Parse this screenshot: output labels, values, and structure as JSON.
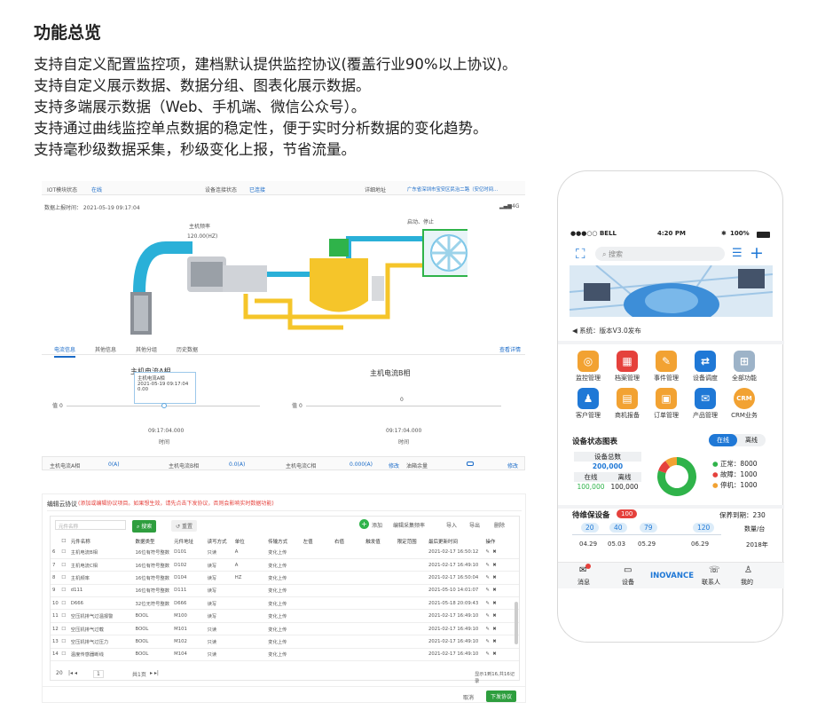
{
  "intro": {
    "title": "功能总览",
    "lines": [
      "支持自定义配置监控项，建档默认提供监控协议(覆盖行业90%以上协议)。",
      "支持自定义展示数据、数据分组、图表化展示数据。",
      "支持多端展示数据（Web、手机端、微信公众号）。",
      "支持通过曲线监控单点数据的稳定性，便于实时分析数据的变化趋势。",
      "支持毫秒级数据采集，秒级变化上报，节省流量。"
    ]
  },
  "monitor": {
    "status_row": {
      "iot_label": "IOT模块状态",
      "iot_value": "在线",
      "conn_label": "设备连接状态",
      "conn_value": "已连接",
      "addr_label": "详细地址",
      "addr_value": "广东省深圳市宝安区民治二路（安亿时间..."
    },
    "report_time": "数据上报时间：  2021-05-19 09:17:04",
    "signal": "4G",
    "freq_label": "主机频率",
    "freq_value": "120.00(HZ)",
    "state": "启动、停止",
    "tabs": [
      "电流信息",
      "其他信息",
      "其他分组",
      "历史数据"
    ],
    "detail_link": "查看详情",
    "chart_a": {
      "title": "主机电流A相",
      "tooltip": [
        "主机电流A相",
        "2021-05-19 09:17:04",
        "0.00"
      ],
      "ylabel": "值",
      "y0": "0",
      "xtick": "09:17:04.000",
      "xlabel": "时间"
    },
    "chart_b": {
      "title": "主机电流B相",
      "ylabel": "值",
      "y0": "0",
      "y_value": "0",
      "xtick": "09:17:04.000",
      "xlabel": "时间"
    },
    "bottom": [
      "主机电流A相",
      "0(A)",
      "主机电流B相",
      "0.0(A)",
      "主机电流C相",
      "0.000(A)",
      "修改",
      "油箱余量",
      "修改"
    ]
  },
  "editor": {
    "title": "编辑云协议",
    "hint": "(添加或编辑协议项目。如果想生效，请先点击下发协议，否则会影响实时数据功能)",
    "search_placeholder": "元件名称",
    "search_btn": "搜索",
    "reset_btn": "重置",
    "tools": [
      "添加",
      "编辑采集频率",
      "导入",
      "导出",
      "删除"
    ],
    "headers": [
      "",
      "",
      "元件名称",
      "数据类型",
      "元件地址",
      "读写方式",
      "单位",
      "传输方式",
      "左值",
      "右值",
      "触发值",
      "限定范围",
      "最后更新时间",
      "操作"
    ],
    "rows": [
      [
        "6",
        "主机电流B相",
        "16位有符号整数",
        "D101",
        "只读",
        "A",
        "变化上传",
        "2021-02-17 16:50:12"
      ],
      [
        "7",
        "主机电流C相",
        "16位有符号整数",
        "D102",
        "读写",
        "A",
        "变化上传",
        "2021-02-17 16:49:10"
      ],
      [
        "8",
        "主机频率",
        "16位有符号整数",
        "D104",
        "读写",
        "HZ",
        "变化上传",
        "2021-02-17 16:50:04"
      ],
      [
        "9",
        "d111",
        "16位有符号整数",
        "D111",
        "读写",
        "",
        "变化上传",
        "2021-05-10 14:01:07"
      ],
      [
        "10",
        "D666",
        "32位无符号整数",
        "D666",
        "读写",
        "",
        "变化上传",
        "2021-05-18 20:09:43"
      ],
      [
        "11",
        "空压机排气过温报警",
        "BOOL",
        "M100",
        "读写",
        "",
        "变化上传",
        "2021-02-17 16:49:10"
      ],
      [
        "12",
        "空压机排气过载",
        "BOOL",
        "M101",
        "只读",
        "",
        "变化上传",
        "2021-02-17 16:49:10"
      ],
      [
        "13",
        "空压机排气过压力",
        "BOOL",
        "M102",
        "只读",
        "",
        "变化上传",
        "2021-02-17 16:49:10"
      ],
      [
        "14",
        "温度传感器断线",
        "BOOL",
        "M104",
        "只读",
        "",
        "变化上传",
        "2021-02-17 16:49:10"
      ]
    ],
    "pager": {
      "size": "20",
      "page": "1",
      "total_pages": "共1页",
      "summary": "显示1到16,共16记录"
    },
    "cancel": "取消",
    "send": "下发协议"
  },
  "phone": {
    "carrier": "●●●○○ BELL",
    "time": "4:20 PM",
    "battery": "100%",
    "search_placeholder": "搜索",
    "notice": "系统：版本V3.0发布",
    "apps": [
      {
        "label": "监控管理",
        "color": "#f2a232",
        "glyph": "◎"
      },
      {
        "label": "档案管理",
        "color": "#e5413c",
        "glyph": "▦"
      },
      {
        "label": "事件管理",
        "color": "#f2a232",
        "glyph": "✎"
      },
      {
        "label": "设备调度",
        "color": "#1f78d6",
        "glyph": "⇄"
      },
      {
        "label": "全部功能",
        "color": "#9db3c8",
        "glyph": "⊞"
      },
      {
        "label": "客户管理",
        "color": "#1f78d6",
        "glyph": "♟"
      },
      {
        "label": "商机报备",
        "color": "#f2a232",
        "glyph": "▤"
      },
      {
        "label": "订单管理",
        "color": "#f2a232",
        "glyph": "▣"
      },
      {
        "label": "产品管理",
        "color": "#1f78d6",
        "glyph": "✉"
      },
      {
        "label": "CRM业务",
        "color": "#f2a232",
        "glyph": "CRM"
      }
    ],
    "status_title": "设备状态图表",
    "seg_on": "在线",
    "seg_off": "离线",
    "total_label": "设备总数",
    "total_value": "200,000",
    "online_label": "在线",
    "offline_label": "离线",
    "online_value": "100,000",
    "offline_value": "100,000",
    "legend": [
      {
        "label": "正常：8000",
        "color": "#2fb34a"
      },
      {
        "label": "故障：1000",
        "color": "#e5413c"
      },
      {
        "label": "停机：1000",
        "color": "#f2a232"
      }
    ],
    "donut": [
      {
        "name": "正常",
        "value": 8000,
        "color": "#2fb34a"
      },
      {
        "name": "故障",
        "value": 1000,
        "color": "#e5413c"
      },
      {
        "name": "停机",
        "value": 1000,
        "color": "#f2a232"
      }
    ],
    "maint_title": "待维保设备",
    "maint_badge": "100",
    "maint_due": "保养到期：230",
    "timeline": {
      "values": [
        "20",
        "40",
        "79",
        "120"
      ],
      "dates": [
        "04.29",
        "05.03",
        "05.29",
        "06.29"
      ],
      "unit": "数量/台",
      "year": "2018年"
    },
    "tabbar": [
      "消息",
      "设备",
      "INOVANCE",
      "联系人",
      "我的"
    ]
  }
}
